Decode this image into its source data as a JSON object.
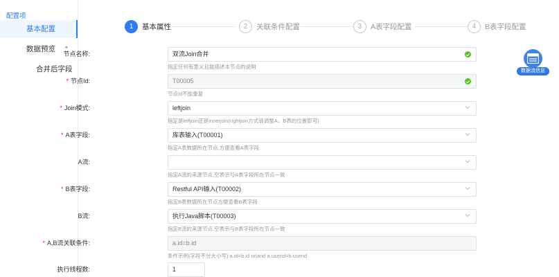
{
  "sidebar": {
    "section_title": "配置项",
    "items": [
      {
        "label": "基本配置"
      },
      {
        "label": "数据预览"
      },
      {
        "label": "合并后字段"
      }
    ]
  },
  "steps": [
    {
      "num": "1",
      "label": "基本属性"
    },
    {
      "num": "2",
      "label": "关联条件配置"
    },
    {
      "num": "3",
      "label": "A表字段配置"
    },
    {
      "num": "4",
      "label": "B表字段配置"
    }
  ],
  "form": {
    "node_name": {
      "label": "节点名称:",
      "value": "双流Join合并",
      "hint": "指定任何有意义且能描述本节点的说明"
    },
    "node_id": {
      "label": "节点Id:",
      "value": "T00005",
      "hint": "节点Id不能重复"
    },
    "join_mode": {
      "label": "Join模式:",
      "value": "leftjoin",
      "hint": "指定是leftjoin还是innerjoin(rightjoin方式请调整A、B表的位置即可)"
    },
    "a_table": {
      "label": "A表字段:",
      "value": "库表输入(T00001)",
      "hint": "指定A表数据所在节点,方便查看A表字段"
    },
    "a_stream": {
      "label": "A流:",
      "value": "",
      "hint": "指定A流的来源节点,空表示与A表字段所在节点一致"
    },
    "b_table": {
      "label": "B表字段:",
      "value": "Restful API输入(T00002)",
      "hint": "指定B表数据所在节点方便查看B表字段"
    },
    "b_stream": {
      "label": "B流:",
      "value": "执行Java脚本(T00003)",
      "hint": "指定B流的来源节点,空表示与B表字段所在节点一致"
    },
    "join_cond": {
      "label": "A,B流关联条件:",
      "value": "a.id=b.id",
      "hint": "条件示例(字段不分大小写):a.id=b.id or|and a.userid=b.userid"
    },
    "threads": {
      "label": "执行线程数:",
      "value": "1"
    }
  },
  "badge": {
    "label": "数据流信息",
    "icon": "data-flow-icon"
  },
  "colors": {
    "accent": "#2f7cf6",
    "success": "#52c41a",
    "required": "#f5222d"
  }
}
